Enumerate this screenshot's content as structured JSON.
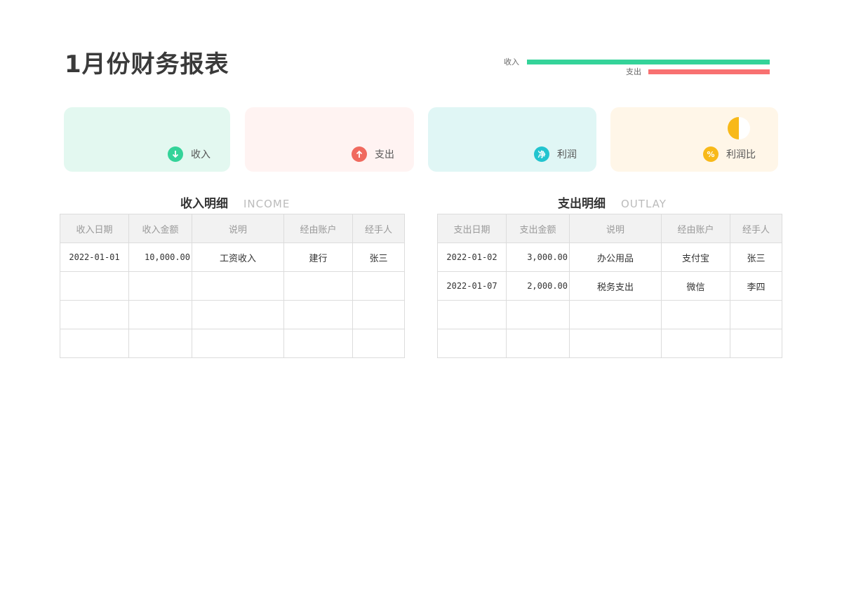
{
  "title": "1月份财务报表",
  "bars": {
    "income": {
      "label": "收入",
      "color": "#34d399",
      "value_fraction": 1.0
    },
    "outlay": {
      "label": "支出",
      "color": "#f87171",
      "value_fraction": 0.5
    }
  },
  "cards": [
    {
      "label": "收入",
      "icon": "arrow-down-icon",
      "icon_color": "#34d399",
      "bg": "#e3f8f0"
    },
    {
      "label": "支出",
      "icon": "arrow-up-icon",
      "icon_color": "#f06a5f",
      "bg": "#fff3f2"
    },
    {
      "label": "利润",
      "icon": "net-icon",
      "icon_glyph": "净",
      "icon_color": "#22c4cf",
      "bg": "#e0f6f5"
    },
    {
      "label": "利润比",
      "icon": "percent-icon",
      "icon_glyph": "%",
      "icon_color": "#f8b919",
      "bg": "#fff6e8",
      "pie_fraction": 0.5
    }
  ],
  "income": {
    "title": "收入明细",
    "title_en": "INCOME",
    "headers": [
      "收入日期",
      "收入金额",
      "说明",
      "经由账户",
      "经手人"
    ],
    "rows": [
      [
        "2022-01-01",
        "10,000.00",
        "工资收入",
        "建行",
        "张三"
      ],
      [
        "",
        "",
        "",
        "",
        ""
      ],
      [
        "",
        "",
        "",
        "",
        ""
      ],
      [
        "",
        "",
        "",
        "",
        ""
      ]
    ]
  },
  "outlay": {
    "title": "支出明细",
    "title_en": "OUTLAY",
    "headers": [
      "支出日期",
      "支出金额",
      "说明",
      "经由账户",
      "经手人"
    ],
    "rows": [
      [
        "2022-01-02",
        "3,000.00",
        "办公用品",
        "支付宝",
        "张三"
      ],
      [
        "2022-01-07",
        "2,000.00",
        "税务支出",
        "微信",
        "李四"
      ],
      [
        "",
        "",
        "",
        "",
        ""
      ],
      [
        "",
        "",
        "",
        "",
        ""
      ]
    ]
  }
}
